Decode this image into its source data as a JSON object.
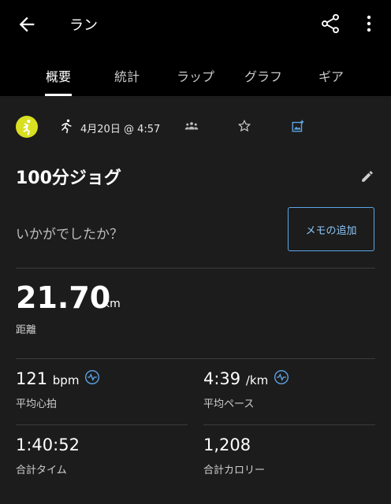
{
  "header": {
    "title": "ラン"
  },
  "tabs": [
    "概要",
    "統計",
    "ラップ",
    "グラフ",
    "ギア"
  ],
  "activity": {
    "date": "4月20日 @ 4:57",
    "name": "100分ジョグ"
  },
  "notes": {
    "prompt": "いかがでしたか？",
    "add_button": "メモの追加"
  },
  "distance": {
    "value": "21.70",
    "unit": "km",
    "label": "距離"
  },
  "stats": [
    {
      "value": "121",
      "unit": "bpm",
      "label": "平均心拍"
    },
    {
      "value": "4:39",
      "unit": "/km",
      "label": "平均ペース"
    },
    {
      "value": "1:40:52",
      "unit": "",
      "label": "合計タイム"
    },
    {
      "value": "1,208",
      "unit": "",
      "label": "合計カロリー"
    }
  ],
  "colors": {
    "accent": "#5ea6e8",
    "logo": "#d8e021"
  }
}
